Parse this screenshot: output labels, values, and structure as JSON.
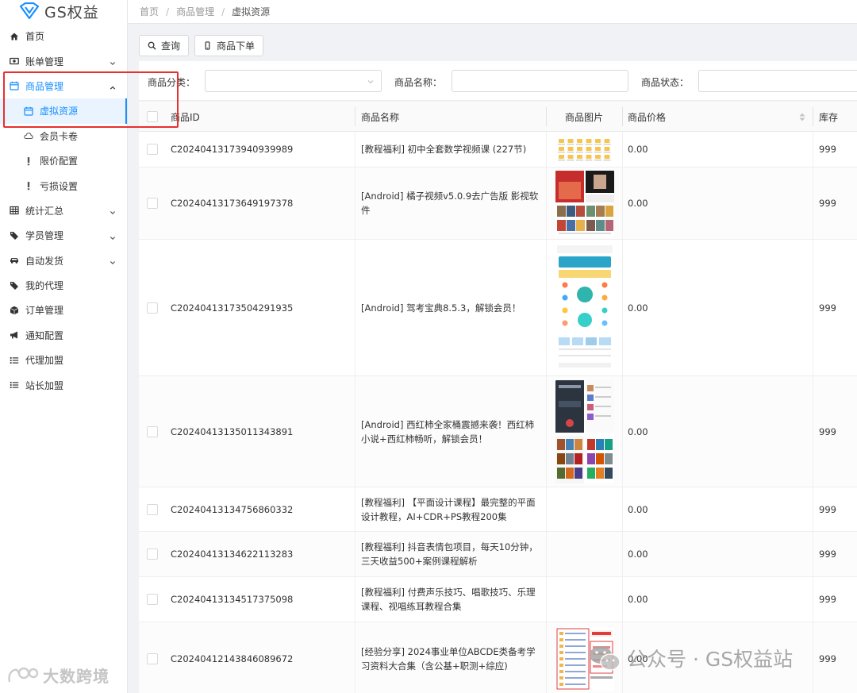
{
  "app": {
    "logo_text": "GS权益"
  },
  "breadcrumb": [
    "首页",
    "商品管理",
    "虚拟资源"
  ],
  "sidebar": {
    "items": [
      {
        "label": "首页",
        "icon": "home-icon",
        "expandable": false
      },
      {
        "label": "账单管理",
        "icon": "money-icon",
        "expandable": true
      },
      {
        "label": "商品管理",
        "icon": "calendar-icon",
        "expandable": true,
        "expanded": true
      },
      {
        "label": "虚拟资源",
        "icon": "calendar-icon",
        "sub": true,
        "active": true
      },
      {
        "label": "会员卡卷",
        "icon": "cloud-icon",
        "sub": true
      },
      {
        "label": "限价配置",
        "icon": "exclamation-icon",
        "sub": true
      },
      {
        "label": "亏损设置",
        "icon": "exclamation-icon",
        "sub": true
      },
      {
        "label": "统计汇总",
        "icon": "table-icon",
        "expandable": true
      },
      {
        "label": "学员管理",
        "icon": "tag-icon",
        "expandable": true
      },
      {
        "label": "自动发货",
        "icon": "car-icon",
        "expandable": true
      },
      {
        "label": "我的代理",
        "icon": "tag-icon",
        "expandable": false
      },
      {
        "label": "订单管理",
        "icon": "cube-icon",
        "expandable": false
      },
      {
        "label": "通知配置",
        "icon": "bullhorn-icon",
        "expandable": false
      },
      {
        "label": "代理加盟",
        "icon": "list-icon",
        "expandable": false
      },
      {
        "label": "站长加盟",
        "icon": "list-icon",
        "expandable": false
      }
    ]
  },
  "toolbar": {
    "query_label": "查询",
    "order_label": "商品下单"
  },
  "filters": {
    "category_label": "商品分类：",
    "name_label": "商品名称：",
    "status_label": "商品状态：",
    "category_value": "",
    "name_value": "",
    "status_value": ""
  },
  "table": {
    "headers": [
      "商品ID",
      "商品名称",
      "商品图片",
      "商品价格",
      "库存"
    ],
    "rows": [
      {
        "id": "C20240413173940939989",
        "name": "[教程福利] 初中全套数学视频课 (227节)",
        "price": "0.00",
        "stock": "999"
      },
      {
        "id": "C20240413173649197378",
        "name": "[Android] 橘子视频v5.0.9去广告版 影视软件",
        "price": "0.00",
        "stock": "999"
      },
      {
        "id": "C20240413173504291935",
        "name": "[Android] 驾考宝典8.5.3，解锁会员！",
        "price": "0.00",
        "stock": "999"
      },
      {
        "id": "C20240413135011343891",
        "name": "[Android] 西红柿全家桶震撼来袭！西红柿小说+西红柿畅听，解锁会员！",
        "price": "0.00",
        "stock": "999"
      },
      {
        "id": "C20240413134756860332",
        "name": "[教程福利] 【平面设计课程】最完整的平面设计教程，AI+CDR+PS教程200集",
        "price": "0.00",
        "stock": "999"
      },
      {
        "id": "C20240413134622113283",
        "name": "[教程福利] 抖音表情包项目，每天10分钟，三天收益500+案例课程解析",
        "price": "0.00",
        "stock": "999"
      },
      {
        "id": "C20240413134517375098",
        "name": "[教程福利] 付费声乐技巧、唱歌技巧、乐理课程、视唱练耳教程合集",
        "price": "0.00",
        "stock": "999"
      },
      {
        "id": "C20240412143846089672",
        "name": "[经验分享] 2024事业单位ABCDE类备考学习资料大合集（含公基+职测+综应)",
        "price": "0.00",
        "stock": "999"
      }
    ]
  },
  "watermarks": {
    "left": "大数跨境",
    "right": "公众号 · GS权益站"
  },
  "colors": {
    "primary": "#1890ff",
    "highlight": "#e6312f"
  }
}
